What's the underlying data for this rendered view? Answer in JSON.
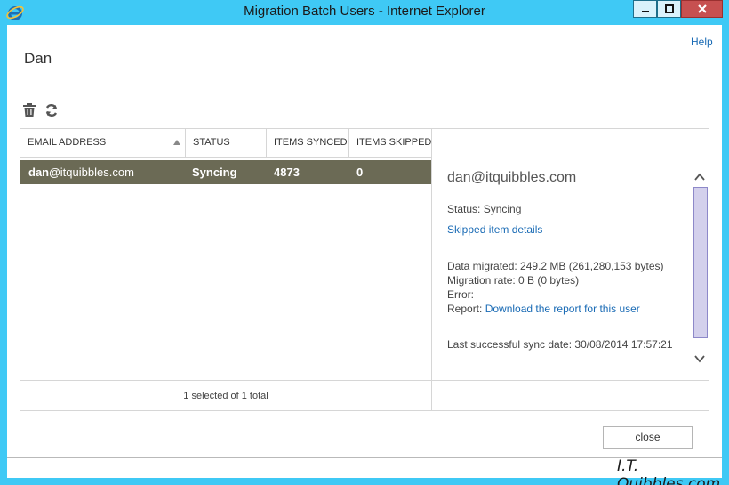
{
  "window": {
    "title": "Migration Batch Users - Internet Explorer",
    "app_icon": "internet-explorer-icon",
    "controls": [
      "minimize-icon",
      "maximize-icon",
      "close-icon"
    ]
  },
  "page": {
    "help_label": "Help",
    "user_name": "Dan"
  },
  "toolbar": {
    "delete_icon": "trash-icon",
    "refresh_icon": "refresh-icon"
  },
  "list": {
    "columns": [
      "EMAIL ADDRESS",
      "STATUS",
      "ITEMS SYNCED",
      "ITEMS SKIPPED"
    ],
    "sort_column": "EMAIL ADDRESS",
    "sort_direction": "ascending",
    "rows": [
      {
        "email_user": "dan@",
        "email_domain": "itquibbles.com",
        "status": "Syncing",
        "items_synced": "4873",
        "items_skipped": "0",
        "selected": true
      }
    ],
    "footer": "1 selected of 1 total"
  },
  "details": {
    "email": "dan@itquibbles.com",
    "status_label": "Status:",
    "status_value": "Syncing",
    "skipped_link": "Skipped item details",
    "data_migrated_label": "Data migrated:",
    "data_migrated_value": "249.2 MB (261,280,153 bytes)",
    "migration_rate_label": "Migration rate:",
    "migration_rate_value": "0 B (0 bytes)",
    "error_label": "Error:",
    "report_label": "Report:",
    "report_link": "Download the report for this user",
    "last_sync_label": "Last successful sync date:",
    "last_sync_value": "30/08/2014 17:57:21"
  },
  "footer": {
    "close_label": "close"
  },
  "watermark": "I.T. Quibbles.com",
  "colors": {
    "titlebar": "#3fc9f5",
    "selected_row": "#6b6a55",
    "link": "#1a6bb5",
    "scroll_thumb": "#d3d0ec",
    "close_button_bg": "#c75050"
  }
}
